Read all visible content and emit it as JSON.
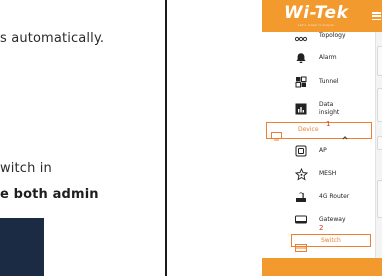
{
  "document": {
    "lines": [
      "s automatically.",
      "witch in",
      "e both admin"
    ]
  },
  "app": {
    "logo": "Wi-Tek",
    "logo_sub": "Let's make it simple",
    "menu": {
      "items": [
        {
          "label": "Topology",
          "icon": "topology-icon"
        },
        {
          "label": "Alarm",
          "icon": "bell-icon"
        },
        {
          "label": "Tunnel",
          "icon": "tunnel-icon"
        },
        {
          "label": "Data insight",
          "icon": "chart-icon"
        },
        {
          "label": "Device",
          "icon": "monitor-icon",
          "expanded": true
        },
        {
          "label": "AP",
          "icon": "ap-icon"
        },
        {
          "label": "MESH",
          "icon": "mesh-icon"
        },
        {
          "label": "4G Router",
          "icon": "router-icon"
        },
        {
          "label": "Gateway",
          "icon": "gateway-icon"
        },
        {
          "label": "Switch",
          "icon": "switch-icon"
        }
      ]
    },
    "annotations": {
      "device": "1",
      "switch": "2"
    },
    "colors": {
      "brand": "#f29a2e",
      "accent": "#ef7f2e",
      "annotation": "#d9321f"
    }
  }
}
